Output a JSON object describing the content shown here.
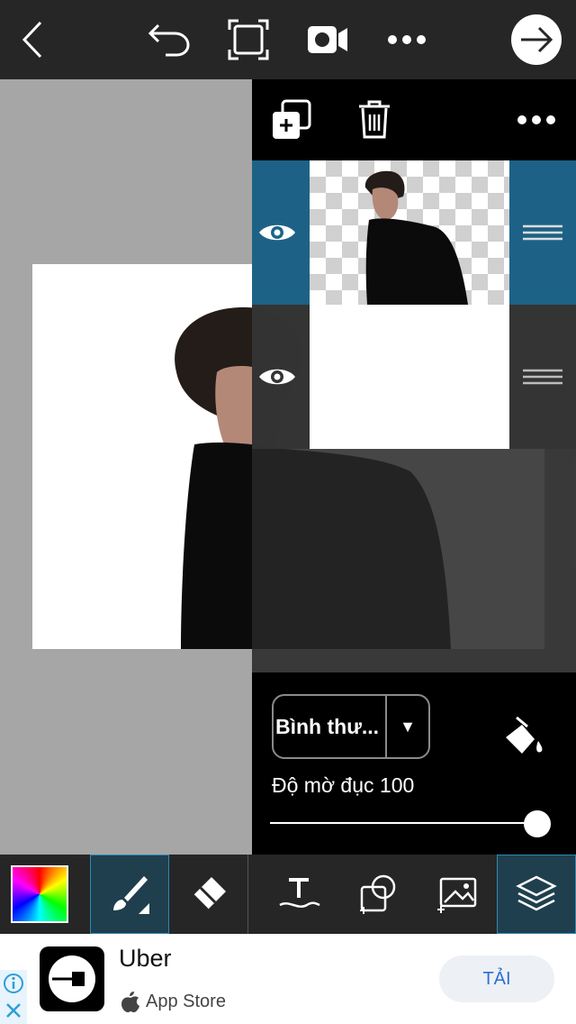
{
  "topbar": {
    "icons": [
      "back-chevron-icon",
      "undo-icon",
      "crop-icon",
      "video-record-icon",
      "more-dots-icon",
      "next-arrow-icon"
    ]
  },
  "layers_panel": {
    "toolbar_icons": [
      "add-layer-icon",
      "trash-icon",
      "more-dots-icon"
    ],
    "layers": [
      {
        "name": "photo-layer",
        "visible": true,
        "selected": true
      },
      {
        "name": "background-layer",
        "visible": true,
        "selected": false
      }
    ],
    "blend_mode": "Bình thư...",
    "opacity_label": "Độ mờ đục 100",
    "opacity_value": 100
  },
  "tools": [
    "color-picker",
    "brush",
    "eraser",
    "text",
    "sticker",
    "add-photo",
    "layers"
  ],
  "ad": {
    "title": "Uber",
    "store": "App Store",
    "cta": "TẢI"
  },
  "colors": {
    "topbar_bg": "#262626",
    "selected_layer": "#1b648a",
    "accent": "#2f88b0"
  }
}
